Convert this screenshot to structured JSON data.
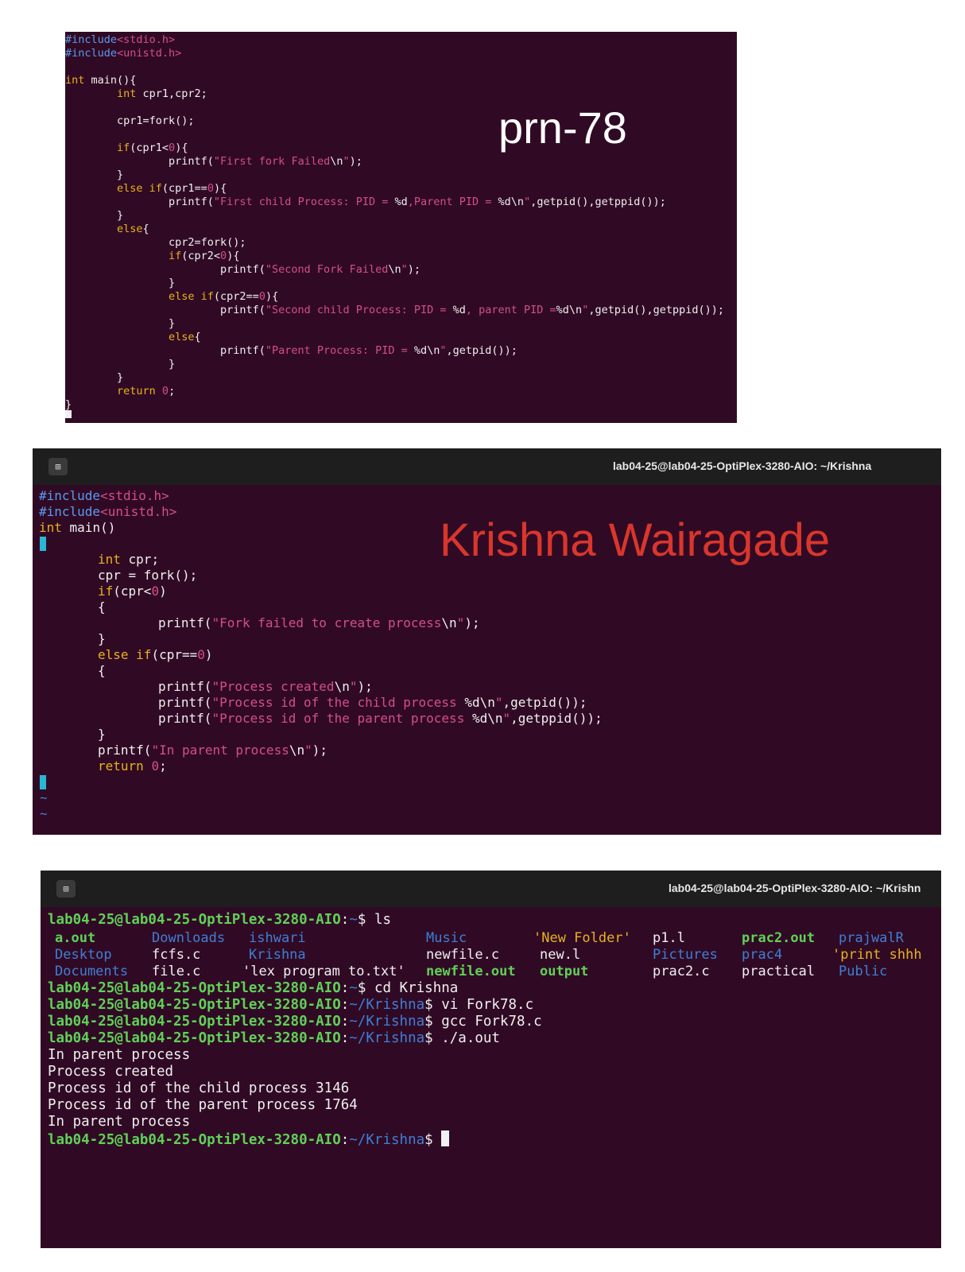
{
  "panel1": {
    "watermark": "prn-78",
    "lines": [
      "#include<stdio.h>",
      "#include<unistd.h>",
      "",
      "int main(){",
      "        int cpr1,cpr2;",
      "",
      "        cpr1=fork();",
      "",
      "        if(cpr1<0){",
      "                printf(\"First fork Failed\\n\");",
      "        }",
      "        else if(cpr1==0){",
      "                printf(\"First child Process: PID = %d,Parent PID = %d\\n\",getpid(),getppid());",
      "        }",
      "        else{",
      "                cpr2=fork();",
      "                if(cpr2<0){",
      "                        printf(\"Second Fork Failed\\n\");",
      "                }",
      "                else if(cpr2==0){",
      "                        printf(\"Second child Process: PID = %d, parent PID =%d\\n\",getpid(),getppid());",
      "                }",
      "                else{",
      "                        printf(\"Parent Process: PID = %d\\n\",getpid());",
      "                }",
      "        }",
      "        return 0;",
      "}"
    ]
  },
  "panel2": {
    "title": "lab04-25@lab04-25-OptiPlex-3280-AIO: ~/Krishna",
    "watermark": "Krishna Wairagade",
    "lines": [
      "#include<stdio.h>",
      "#include<unistd.h>",
      "int main()",
      "{",
      "        int cpr;",
      "        cpr = fork();",
      "        if(cpr<0)",
      "        {",
      "                printf(\"Fork failed to create process\\n\");",
      "        }",
      "        else if(cpr==0)",
      "        {",
      "                printf(\"Process created\\n\");",
      "                printf(\"Process id of the child process %d\\n\",getpid());",
      "                printf(\"Process id of the parent process %d\\n\",getppid());",
      "        }",
      "        printf(\"In parent process\\n\");",
      "        return 0;",
      "}",
      "~",
      "~"
    ]
  },
  "panel3": {
    "title": "lab04-25@lab04-25-OptiPlex-3280-AIO: ~/Krishn",
    "prompt_user": "lab04-25@lab04-25-OptiPlex-3280-AIO",
    "home_path": "~",
    "krishna_path": "~/Krishna",
    "cmd_ls": "ls",
    "ls_columns": [
      [
        "a.out",
        "Desktop",
        "Documents"
      ],
      [
        "Downloads",
        "fcfs.c",
        "file.c"
      ],
      [
        "ishwari",
        "Krishna",
        "'lex program to.txt'"
      ],
      [
        "Music",
        "newfile.c",
        "newfile.out"
      ],
      [
        "'New Folder'",
        "new.l",
        "output"
      ],
      [
        "p1.l",
        "Pictures",
        "prac2.c"
      ],
      [
        "prac2.out",
        "prac4",
        "practical"
      ],
      [
        "prajwalR",
        "'print shhh",
        "Public"
      ]
    ],
    "cmd_cd": "cd Krishna",
    "cmd_vi": "vi Fork78.c",
    "cmd_gcc": "gcc Fork78.c",
    "cmd_run": "./a.out",
    "output": [
      "In parent process",
      "Process created",
      "Process id of the child process 3146",
      "Process id of the parent process 1764",
      "In parent process"
    ]
  },
  "colors": {
    "terminal_bg": "#300a24",
    "prompt_green": "#5fd157",
    "path_blue": "#3f7fd6",
    "string_pink": "#d44e8c",
    "keyword_yellow": "#e7b21e",
    "name_red": "#d9362c"
  }
}
